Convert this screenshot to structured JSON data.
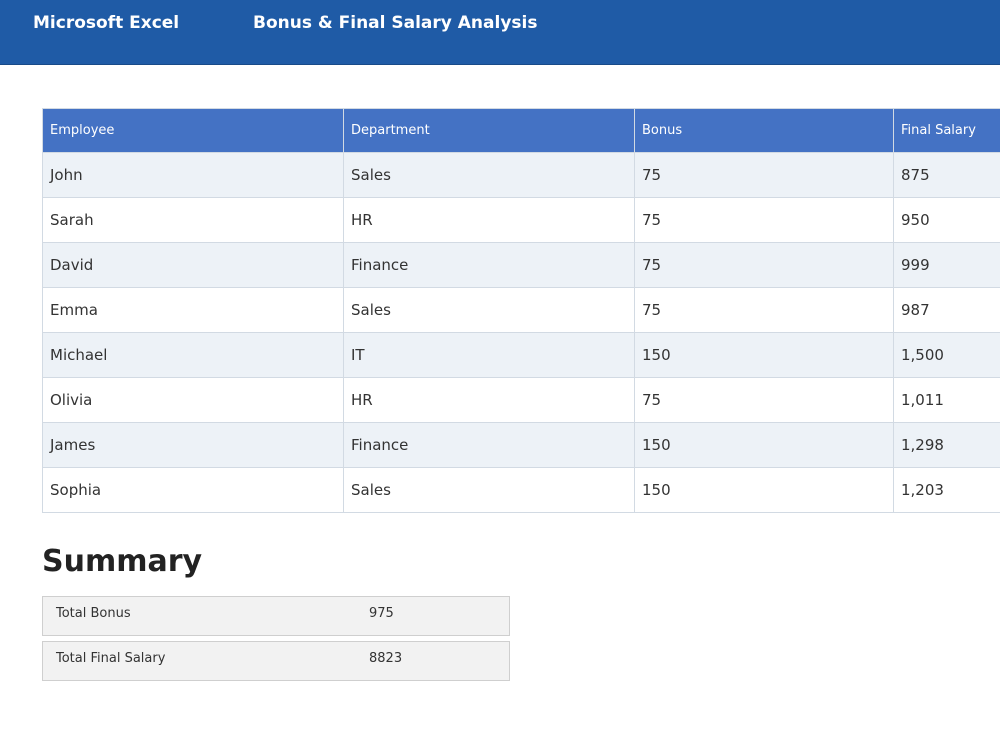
{
  "window": {
    "app_name": "Microsoft Excel",
    "document_title": "Bonus & Final Salary Analysis"
  },
  "table": {
    "headers": [
      "Employee",
      "Department",
      "Bonus",
      "Final Salary"
    ],
    "rows": [
      [
        "John",
        "Sales",
        "75",
        "875"
      ],
      [
        "Sarah",
        "HR",
        "75",
        "950"
      ],
      [
        "David",
        "Finance",
        "75",
        "999"
      ],
      [
        "Emma",
        "Sales",
        "75",
        "987"
      ],
      [
        "Michael",
        "IT",
        "150",
        "1,500"
      ],
      [
        "Olivia",
        "HR",
        "75",
        "1,011"
      ],
      [
        "James",
        "Finance",
        "150",
        "1,298"
      ],
      [
        "Sophia",
        "Sales",
        "150",
        "1,203"
      ]
    ]
  },
  "summary": {
    "title": "Summary",
    "total_bonus_label": "Total Bonus",
    "total_bonus_value": "975",
    "total_final_salary_label": "Total Final Salary",
    "total_final_salary_value": "8823"
  },
  "colors": {
    "titlebar": "#1f5ba6",
    "header_fill": "#4472c4",
    "band_fill": "#edf2f7",
    "summary_fill": "#f2f2f2"
  }
}
